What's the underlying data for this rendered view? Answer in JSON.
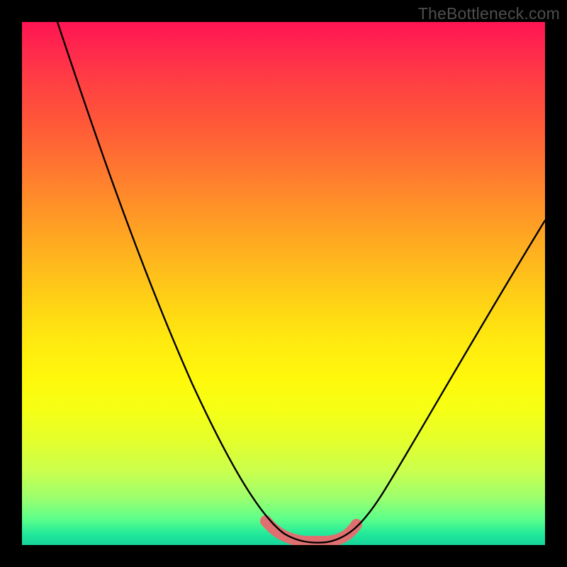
{
  "watermark": "TheBottleneck.com",
  "chart_data": {
    "type": "line",
    "title": "",
    "xlabel": "",
    "ylabel": "",
    "xlim": [
      0,
      100
    ],
    "ylim": [
      0,
      100
    ],
    "series": [
      {
        "name": "black-curve",
        "x": [
          7,
          10,
          15,
          20,
          25,
          30,
          35,
          40,
          45,
          48,
          50,
          52,
          55,
          57,
          59,
          61,
          65,
          70,
          75,
          80,
          85,
          90,
          95,
          100
        ],
        "values": [
          100,
          94,
          83,
          72,
          61,
          50,
          40,
          30,
          20,
          12,
          7,
          3,
          1,
          0,
          0,
          1,
          3,
          9,
          17,
          26,
          35,
          44,
          53,
          62
        ]
      },
      {
        "name": "pink-valley-band",
        "x": [
          48,
          50,
          52,
          55,
          57,
          59,
          61,
          63
        ],
        "values": [
          4,
          2,
          1,
          0,
          0,
          0,
          1,
          2
        ]
      }
    ]
  }
}
